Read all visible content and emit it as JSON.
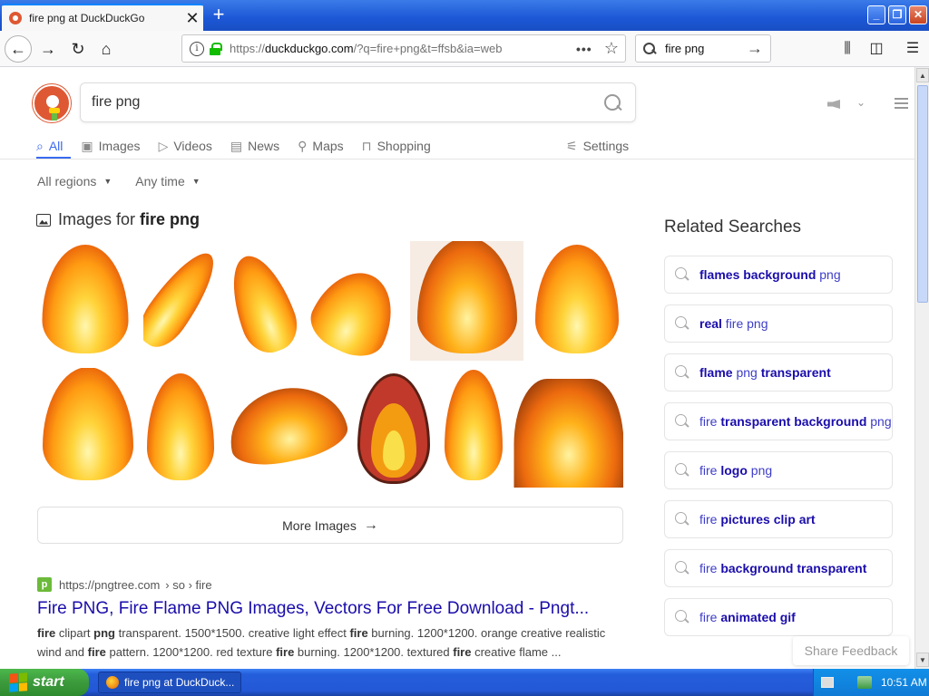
{
  "browser": {
    "tab_title": "fire png at DuckDuckGo",
    "tab_close": "✕",
    "new_tab": "+",
    "url_prefix": "https://",
    "url_domain": "duckduckgo.com",
    "url_path": "/?q=fire+png&t=ffsb&ia=web",
    "url_more": "•••",
    "search_value": "fire png",
    "window_buttons": [
      "_",
      "❐",
      "✕"
    ]
  },
  "ddg": {
    "query": "fire png",
    "tabs": [
      {
        "label": "All",
        "icon": "search-icon",
        "active": true
      },
      {
        "label": "Images",
        "icon": "image-icon"
      },
      {
        "label": "Videos",
        "icon": "play-icon"
      },
      {
        "label": "News",
        "icon": "news-icon"
      },
      {
        "label": "Maps",
        "icon": "map-pin-icon"
      },
      {
        "label": "Shopping",
        "icon": "bag-icon"
      }
    ],
    "settings_label": "Settings",
    "filters": [
      "All regions",
      "Any time"
    ],
    "images_heading_prefix": "Images for",
    "images_heading_query": "fire png",
    "more_images_label": "More Images",
    "result": {
      "url_display": "https://pngtree.com",
      "breadcrumb": "› so › fire",
      "title": "Fire PNG, Fire Flame PNG Images, Vectors For Free Download - Pngt...",
      "snippet_html_parts": [
        {
          "b": true,
          "t": "fire"
        },
        {
          "b": false,
          "t": " clipart "
        },
        {
          "b": true,
          "t": "png"
        },
        {
          "b": false,
          "t": " transparent. 1500*1500. creative light effect "
        },
        {
          "b": true,
          "t": "fire"
        },
        {
          "b": false,
          "t": " burning. 1200*1200. orange creative realistic wind and "
        },
        {
          "b": true,
          "t": "fire"
        },
        {
          "b": false,
          "t": " pattern. 1200*1200. red texture "
        },
        {
          "b": true,
          "t": "fire"
        },
        {
          "b": false,
          "t": " burning. 1200*1200. textured "
        },
        {
          "b": true,
          "t": "fire"
        },
        {
          "b": false,
          "t": " creative flame ..."
        }
      ]
    },
    "related_heading": "Related Searches",
    "related": [
      [
        {
          "b": true,
          "t": "flames background"
        },
        {
          "b": false,
          "t": " png"
        }
      ],
      [
        {
          "b": true,
          "t": "real"
        },
        {
          "b": false,
          "t": " fire png"
        }
      ],
      [
        {
          "b": true,
          "t": "flame"
        },
        {
          "b": false,
          "t": " png "
        },
        {
          "b": true,
          "t": "transparent"
        }
      ],
      [
        {
          "b": false,
          "t": "fire "
        },
        {
          "b": true,
          "t": "transparent background"
        },
        {
          "b": false,
          "t": " png"
        }
      ],
      [
        {
          "b": false,
          "t": "fire "
        },
        {
          "b": true,
          "t": "logo"
        },
        {
          "b": false,
          "t": " png"
        }
      ],
      [
        {
          "b": false,
          "t": "fire "
        },
        {
          "b": true,
          "t": "pictures clip art"
        }
      ],
      [
        {
          "b": false,
          "t": "fire "
        },
        {
          "b": true,
          "t": "background transparent"
        }
      ],
      [
        {
          "b": false,
          "t": "fire "
        },
        {
          "b": true,
          "t": "animated gif"
        }
      ]
    ],
    "share_feedback": "Share Feedback"
  },
  "taskbar": {
    "start_label": "start",
    "task_label": "fire png at DuckDuck...",
    "clock": "10:51 AM"
  },
  "colors": {
    "accent": "#3969ef",
    "link": "#1a0dab",
    "ddg_orange": "#de5833"
  }
}
